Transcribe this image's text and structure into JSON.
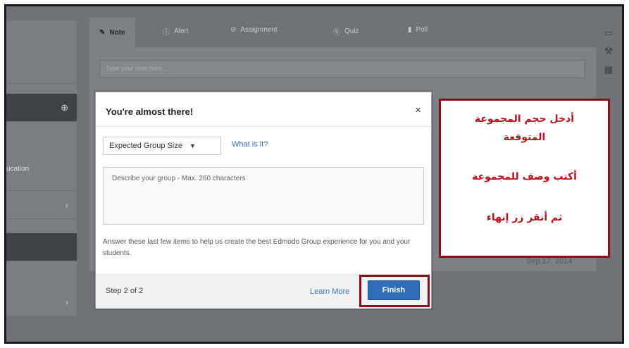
{
  "tabs": [
    {
      "icon": "edit-icon",
      "label": "Note"
    },
    {
      "icon": "alert-icon",
      "label": "Alert"
    },
    {
      "icon": "assignment-icon",
      "label": "Assignment"
    },
    {
      "icon": "quiz-icon",
      "label": "Quiz"
    },
    {
      "icon": "poll-icon",
      "label": "Poll"
    }
  ],
  "note": {
    "placeholder": "Type your note here..."
  },
  "sidebar": {
    "partial_label": "ucation"
  },
  "background": {
    "date": "Sep 17, 2014"
  },
  "modal": {
    "title": "You're almost there!",
    "close": "×",
    "group_size_select": "Expected Group Size",
    "what_is_it": "What is it?",
    "description_placeholder": "Describe your group - Max. 260 characters",
    "help_text": "Answer these last few items to help us create the best Edmodo Group experience for you and your students.",
    "step": "Step 2 of 2",
    "learn_more": "Learn More",
    "finish": "Finish"
  },
  "callout": {
    "line1": "أدخل حجم المجموعة",
    "line2": "المتوقعة",
    "line3": "أكتب وصف للمجموعة",
    "line4": "ثم أنقر زر إنهاء"
  },
  "colors": {
    "accent": "#2e6db7",
    "highlight": "#8b0f1a",
    "callout_text": "#b7121c"
  }
}
